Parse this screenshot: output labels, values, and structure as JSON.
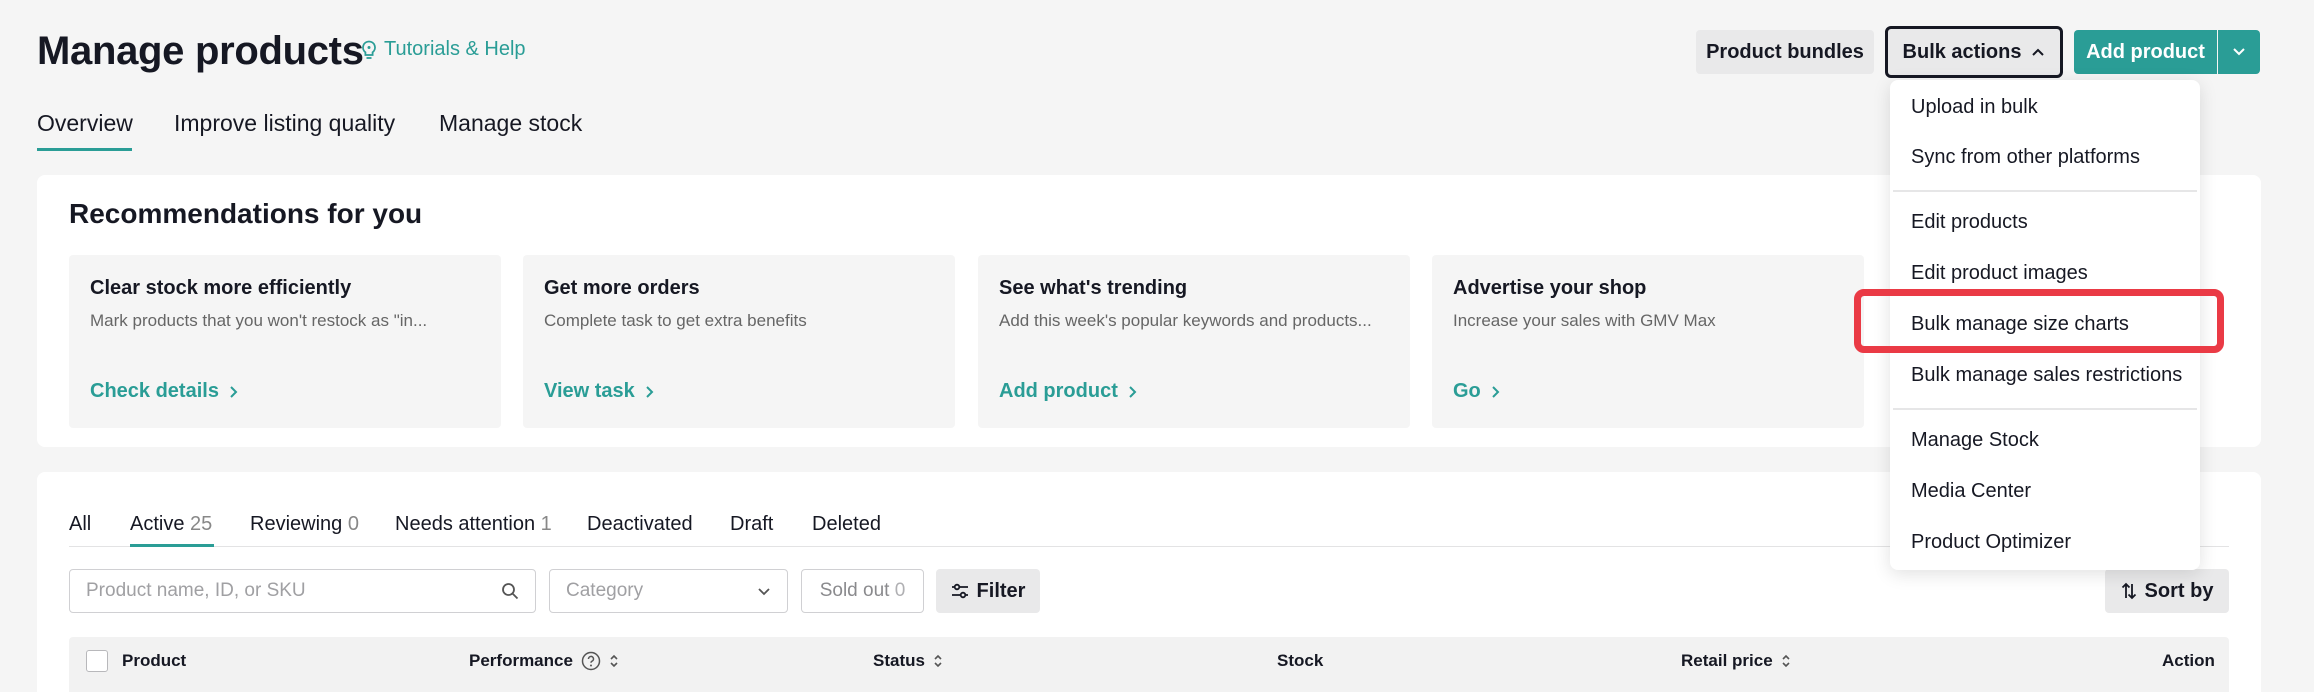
{
  "header": {
    "title": "Manage products",
    "help_link": "Tutorials & Help",
    "product_bundles": "Product bundles",
    "bulk_actions": "Bulk actions",
    "add_product": "Add product"
  },
  "tabs": [
    "Overview",
    "Improve listing quality",
    "Manage stock"
  ],
  "recommendations": {
    "title": "Recommendations for you",
    "tiles": [
      {
        "title": "Clear stock more efficiently",
        "desc": "Mark products that you won't restock as \"in...",
        "link": "Check details"
      },
      {
        "title": "Get more orders",
        "desc": "Complete task to get extra benefits",
        "link": "View task"
      },
      {
        "title": "See what's trending",
        "desc": "Add this week's popular keywords and products...",
        "link": "Add product"
      },
      {
        "title": "Advertise your shop",
        "desc": "Increase your sales with GMV Max",
        "link": "Go"
      }
    ]
  },
  "product_tabs": [
    {
      "label": "All",
      "count": ""
    },
    {
      "label": "Active",
      "count": "25"
    },
    {
      "label": "Reviewing",
      "count": "0"
    },
    {
      "label": "Needs attention",
      "count": "1"
    },
    {
      "label": "Deactivated",
      "count": ""
    },
    {
      "label": "Draft",
      "count": ""
    },
    {
      "label": "Deleted",
      "count": ""
    }
  ],
  "filters": {
    "search_placeholder": "Product name, ID, or SKU",
    "category": "Category",
    "sold_out_label": "Sold out",
    "sold_out_count": "0",
    "filter": "Filter",
    "sort_by": "Sort by"
  },
  "table_headers": {
    "product": "Product",
    "performance": "Performance",
    "status": "Status",
    "stock": "Stock",
    "retail_price": "Retail price",
    "action": "Action"
  },
  "bulk_menu": {
    "items": [
      "Upload in bulk",
      "Sync from other platforms",
      "Edit products",
      "Edit product images",
      "Bulk manage size charts",
      "Bulk manage sales restrictions",
      "Manage Stock",
      "Media Center",
      "Product Optimizer"
    ]
  },
  "colors": {
    "accent": "#2a9d96",
    "highlight": "#ea3a45",
    "background": "#f5f5f5"
  }
}
